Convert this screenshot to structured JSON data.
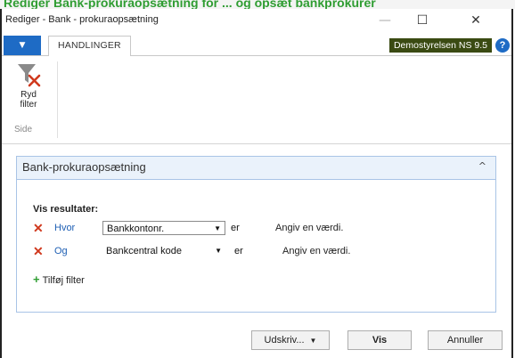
{
  "banner": {
    "text": "Rediger Bank-prokuraopsætning for ... og opsæt bankprokurer"
  },
  "window": {
    "title": "Rediger - Bank - prokuraopsætning"
  },
  "window_buttons": {
    "minimize": "—",
    "maximize": "☐",
    "close": "✕"
  },
  "ribbon": {
    "menu_glyph": "▼",
    "tab": "HANDLINGER",
    "company": "Demostyrelsen NS 9.5",
    "help": "?",
    "button": {
      "label_line1": "Ryd",
      "label_line2": "filter",
      "icon": "clear-filter-icon"
    },
    "group_label": "Side"
  },
  "panel": {
    "title": "Bank-prokuraopsætning",
    "collapse_glyph": "^",
    "results_label": "Vis resultater:",
    "filters": [
      {
        "keyword": "Hvor",
        "field": "Bankkontonr.",
        "operator": "er",
        "placeholder": "Angiv en værdi."
      },
      {
        "keyword": "Og",
        "field": "Bankcentral kode",
        "operator": "er",
        "placeholder": "Angiv en værdi."
      }
    ],
    "add_filter": "Tilføj filter",
    "add_filter_glyph": "+",
    "remove_glyph": "✕",
    "dropdown_glyph": "▼"
  },
  "footer": {
    "print": "Udskriv...",
    "print_glyph": "▼",
    "vis": "Vis",
    "cancel": "Annuller"
  },
  "colors": {
    "accent": "#1e6bc5",
    "company_badge": "#3a4a12",
    "remove": "#d0391e",
    "add": "#2f9d32",
    "panel_border": "#a9c4e6"
  }
}
